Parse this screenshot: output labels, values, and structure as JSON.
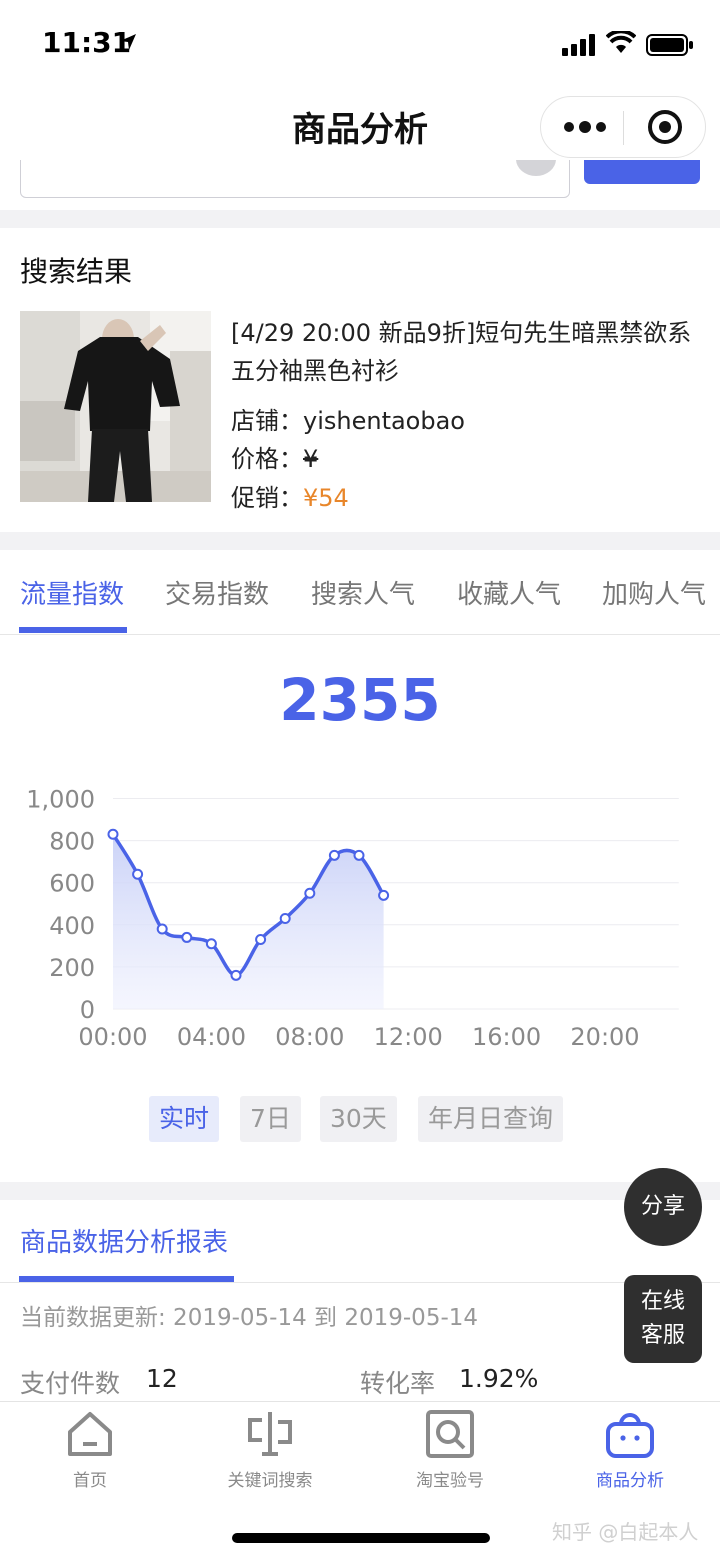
{
  "status_bar": {
    "time": "11:31"
  },
  "nav": {
    "title": "商品分析"
  },
  "result": {
    "section_title": "搜索结果",
    "product_name": "[4/29 20:00 新品9折]短句先生暗黑禁欲系五分袖黑色衬衫",
    "shop_label": "店铺：",
    "shop_value": "yishentaobao",
    "price_label": "价格：",
    "price_value": "¥",
    "promo_label": "促销：",
    "promo_value": "¥54"
  },
  "tabs": [
    "流量指数",
    "交易指数",
    "搜索人气",
    "收藏人气",
    "加购人气"
  ],
  "active_tab": 0,
  "big_number": "2355",
  "chart_data": {
    "type": "area",
    "x_labels": [
      "00:00",
      "01:00",
      "02:00",
      "03:00",
      "04:00",
      "05:00",
      "06:00",
      "07:00",
      "08:00",
      "09:00",
      "10:00",
      "11:00"
    ],
    "values": [
      830,
      640,
      380,
      340,
      310,
      160,
      330,
      430,
      550,
      730,
      730,
      540
    ],
    "x_ticks": [
      "00:00",
      "04:00",
      "08:00",
      "12:00",
      "16:00",
      "20:00"
    ],
    "y_ticks": [
      "0",
      "200",
      "400",
      "600",
      "800",
      "1,000"
    ],
    "xlim": [
      "00:00",
      "23:00"
    ],
    "ylim": [
      0,
      1000
    ],
    "smooth": true,
    "grid": true,
    "line_color": "#4a63e7"
  },
  "range_buttons": [
    "实时",
    "7日",
    "30天",
    "年月日查询"
  ],
  "report": {
    "title": "商品数据分析报表",
    "update": "当前数据更新: 2019-05-14 到 2019-05-14",
    "stats": [
      {
        "label": "支付件数",
        "value": "12"
      },
      {
        "label": "转化率",
        "value": "1.92%"
      }
    ]
  },
  "float": {
    "share": "分享",
    "service_line1": "在线",
    "service_line2": "客服"
  },
  "tabbar": [
    {
      "label": "首页",
      "icon": "home-icon"
    },
    {
      "label": "关键词搜索",
      "icon": "keyword-search-icon"
    },
    {
      "label": "淘宝验号",
      "icon": "account-check-icon"
    },
    {
      "label": "商品分析",
      "icon": "shopping-bag-icon"
    }
  ],
  "watermark": "知乎 @白起本人",
  "colors": {
    "accent": "#4a63e7",
    "promo": "#e8862a"
  }
}
